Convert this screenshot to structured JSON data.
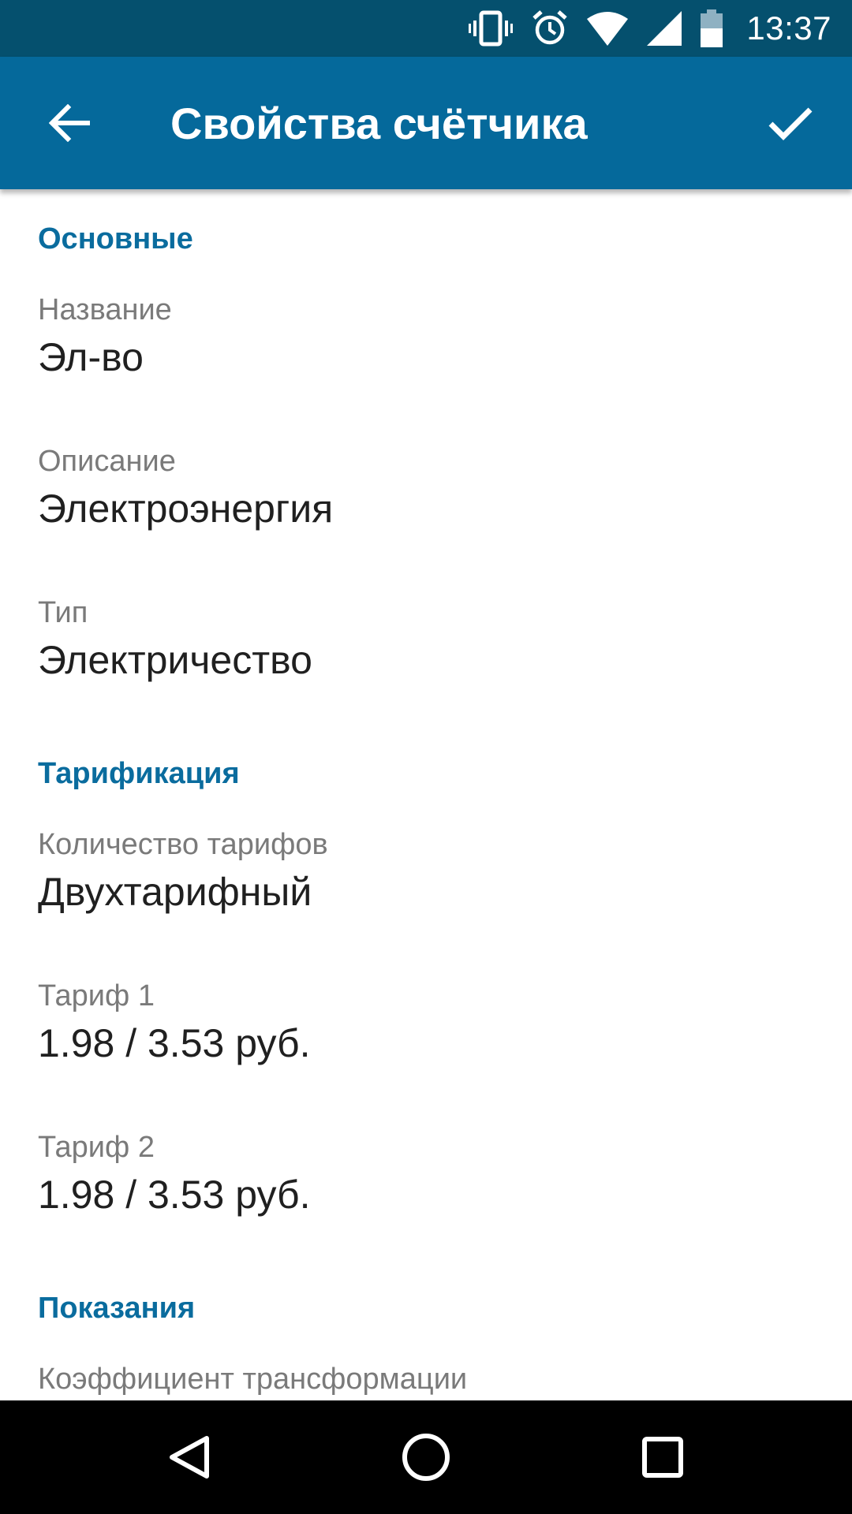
{
  "status_bar": {
    "time": "13:37",
    "icons": [
      "vibrate-icon",
      "alarm-icon",
      "wifi-icon",
      "signal-icon",
      "battery-icon"
    ]
  },
  "app_bar": {
    "title": "Свойства счётчика",
    "back_icon": "arrow-back-icon",
    "confirm_icon": "checkmark-icon",
    "color": "#05699b"
  },
  "sections": {
    "main": {
      "header": "Основные",
      "name": {
        "title": "Название",
        "summary": "Эл-во"
      },
      "description": {
        "title": "Описание",
        "summary": "Электроэнергия"
      },
      "type": {
        "title": "Тип",
        "summary": "Электричество"
      }
    },
    "tariffs": {
      "header": "Тарификация",
      "count": {
        "title": "Количество тарифов",
        "summary": "Двухтарифный"
      },
      "tariff1": {
        "title": "Тариф 1",
        "summary": "1.98 / 3.53 руб."
      },
      "tariff2": {
        "title": "Тариф 2",
        "summary": "1.98 / 3.53 руб."
      }
    },
    "readings": {
      "header": "Показания",
      "ratio": {
        "title": "Коэффициент трансформации"
      }
    }
  },
  "accent_color": "#0a6c9e",
  "nav_bar": {
    "buttons": [
      "back-triangle-icon",
      "home-circle-icon",
      "recents-square-icon"
    ]
  }
}
